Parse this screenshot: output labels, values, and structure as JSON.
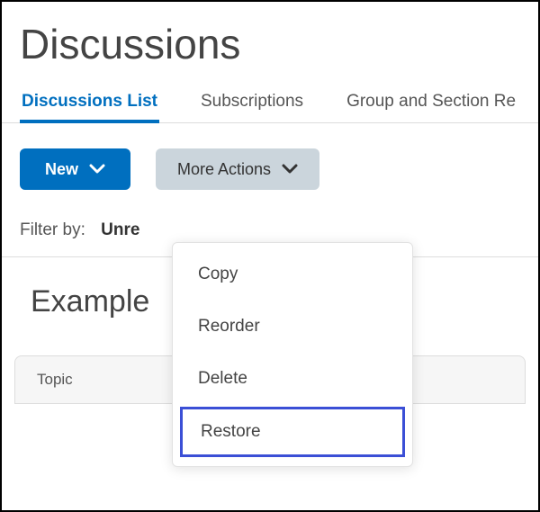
{
  "page_title": "Discussions",
  "tabs": {
    "item0": "Discussions List",
    "item1": "Subscriptions",
    "item2": "Group and Section Re"
  },
  "toolbar": {
    "new_label": "New",
    "more_actions_label": "More Actions"
  },
  "filter": {
    "label": "Filter by:",
    "value": "Unre"
  },
  "section": {
    "title": "Example"
  },
  "table": {
    "col0": "Topic"
  },
  "menu": {
    "item0": "Copy",
    "item1": "Reorder",
    "item2": "Delete",
    "item3": "Restore"
  }
}
